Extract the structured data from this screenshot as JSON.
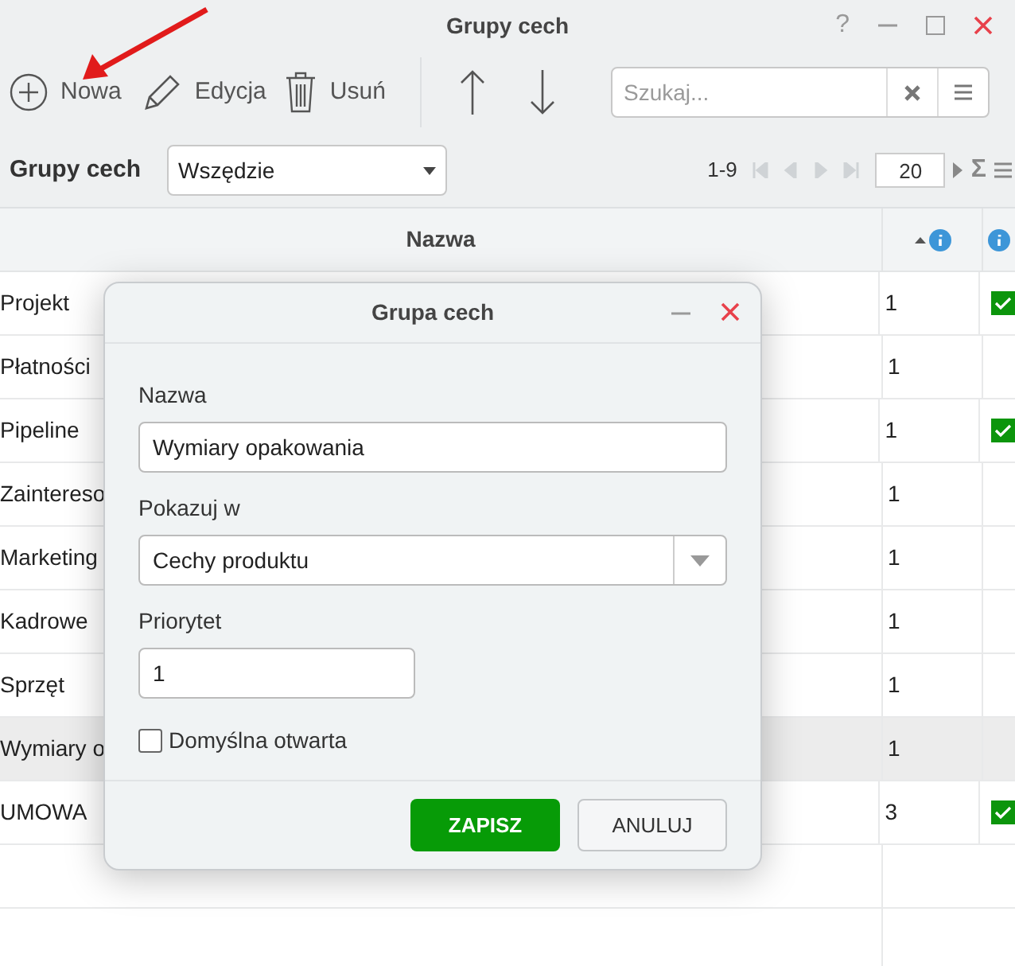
{
  "window": {
    "title": "Grupy cech",
    "help": "?"
  },
  "toolbar": [
    {
      "kind": "add",
      "label": "Nowa"
    },
    {
      "kind": "edit",
      "label": "Edycja"
    },
    {
      "kind": "delete",
      "label": "Usuń"
    },
    {
      "kind": "up"
    },
    {
      "kind": "down"
    }
  ],
  "search": {
    "placeholder": "Szukaj..."
  },
  "filter": {
    "label": "Grupy cech",
    "value": "Wszędzie"
  },
  "pager": {
    "range": "1-9",
    "page_size": "20",
    "sum": "Σ"
  },
  "table": {
    "columns": [
      {
        "label": "Nazwa",
        "sorted": false
      },
      {
        "sorted": true
      },
      {
        "sorted": false
      }
    ],
    "rows": [
      {
        "name": "Projekt",
        "priority": "1",
        "checked": true,
        "selected": false
      },
      {
        "name": "Płatności",
        "priority": "1",
        "checked": false,
        "selected": false
      },
      {
        "name": "Pipeline",
        "priority": "1",
        "checked": true,
        "selected": false
      },
      {
        "name": "Zaintereso",
        "priority": "1",
        "checked": false,
        "selected": false
      },
      {
        "name": "Marketing",
        "priority": "1",
        "checked": false,
        "selected": false
      },
      {
        "name": "Kadrowe",
        "priority": "1",
        "checked": false,
        "selected": false
      },
      {
        "name": "Sprzęt",
        "priority": "1",
        "checked": false,
        "selected": false
      },
      {
        "name": "Wymiary o",
        "priority": "1",
        "checked": false,
        "selected": true
      },
      {
        "name": "UMOWA",
        "priority": "3",
        "checked": true,
        "selected": false
      }
    ]
  },
  "dialog": {
    "title": "Grupa cech",
    "fields": [
      {
        "kind": "text",
        "label": "Nazwa",
        "value": "Wymiary opakowania"
      },
      {
        "kind": "select",
        "label": "Pokazuj w",
        "value": "Cechy produktu"
      },
      {
        "kind": "number",
        "label": "Priorytet",
        "value": "1"
      },
      {
        "kind": "checkbox",
        "label": "Domyślna otwarta",
        "checked": false
      }
    ],
    "buttons": [
      {
        "kind": "primary",
        "label": "ZAPISZ"
      },
      {
        "kind": "secondary",
        "label": "ANULUJ"
      }
    ]
  }
}
